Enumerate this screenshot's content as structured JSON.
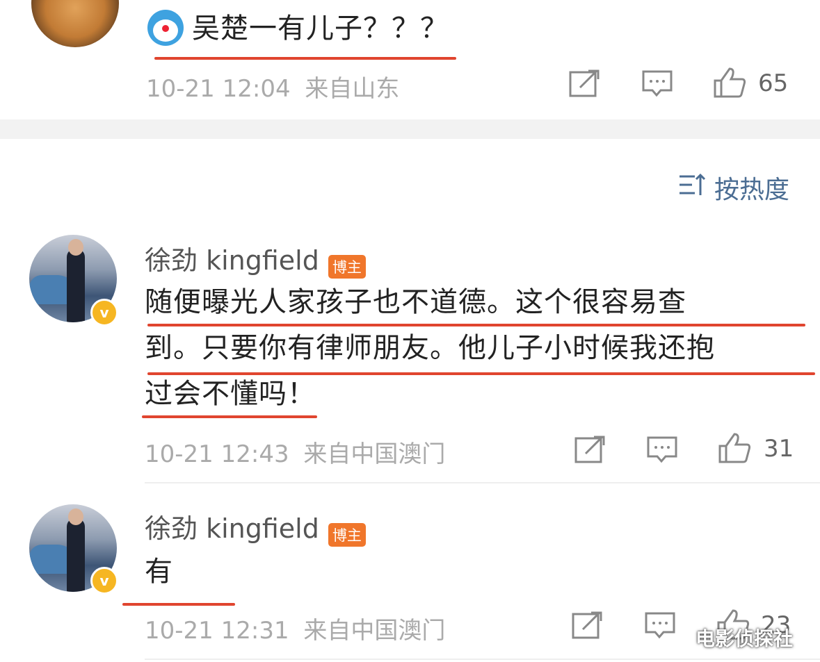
{
  "top_comment": {
    "text": "吴楚一有儿子？？？",
    "time": "10-21 12:04",
    "source": "来自山东",
    "likes": "65"
  },
  "sort": {
    "label": "按热度"
  },
  "comments": [
    {
      "author": "徐劲 kingfield",
      "badge": "博主",
      "lines": [
        "随便曝光人家孩子也不道德。这个很容易查",
        "到。只要你有律师朋友。他儿子小时候我还抱",
        "过会不懂吗！"
      ],
      "time": "10-21 12:43",
      "source": "来自中国澳门",
      "likes": "31"
    },
    {
      "author": "徐劲 kingfield",
      "badge": "博主",
      "lines": [
        "有"
      ],
      "time": "10-21 12:31",
      "source": "来自中国澳门",
      "likes": "23"
    }
  ],
  "watermark": "电影侦探社",
  "colors": {
    "underline": "#e0452f",
    "badge": "#f0762b",
    "verified": "#f6b622",
    "sort": "#4b6d93"
  }
}
